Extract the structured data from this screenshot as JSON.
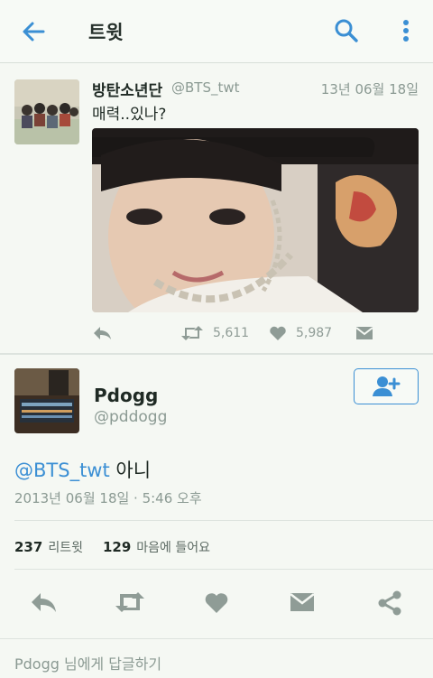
{
  "header": {
    "title": "트윗"
  },
  "quoted_tweet": {
    "name": "방탄소년단",
    "handle": "@BTS_twt",
    "date": "13년 06월 18일",
    "text": "매력..있나?",
    "retweets": "5,611",
    "likes": "5,987"
  },
  "main_tweet": {
    "name": "Pdogg",
    "handle": "@pddogg",
    "mention": "@BTS_twt",
    "text": " 아니",
    "timestamp": "2013년 06월 18일 · 5:46 오후",
    "retweet_count": "237",
    "retweet_label": "리트윗",
    "like_count": "129",
    "like_label": "마음에 들어요"
  },
  "reply_box": {
    "placeholder": "Pdogg 님에게 답글하기"
  },
  "colors": {
    "accent": "#3b8fd4",
    "muted": "#8b9a93",
    "background": "#f5f8f3"
  },
  "icons": [
    "back-arrow-icon",
    "search-icon",
    "more-vertical-icon",
    "reply-icon",
    "retweet-icon",
    "heart-icon",
    "message-icon",
    "share-icon",
    "follow-user-icon"
  ]
}
